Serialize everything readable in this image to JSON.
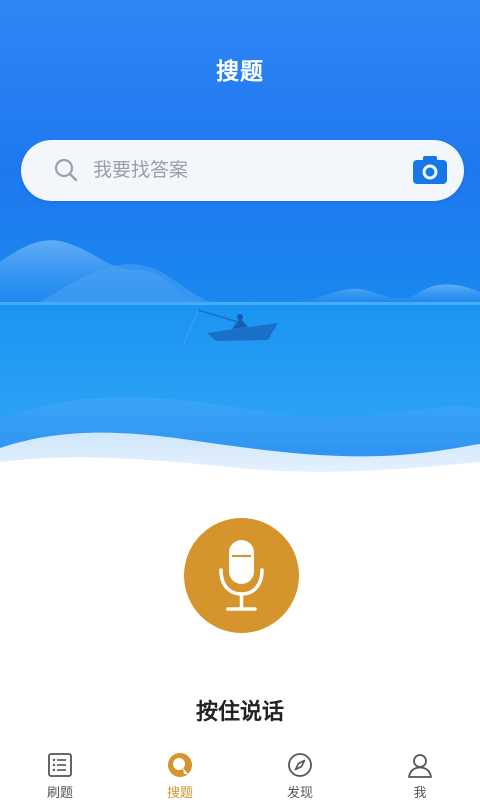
{
  "header": {
    "title": "搜题"
  },
  "search": {
    "placeholder": "我要找答案"
  },
  "icons": {
    "search": "search-icon",
    "camera": "camera-icon",
    "microphone": "microphone-icon",
    "tab_brush": "list-icon",
    "tab_search": "search-circle-icon",
    "tab_discover": "compass-icon",
    "tab_me": "person-icon"
  },
  "voice": {
    "label": "按住说话"
  },
  "tabs": [
    {
      "label": "刷题",
      "active": false
    },
    {
      "label": "搜题",
      "active": true
    },
    {
      "label": "发现",
      "active": false
    },
    {
      "label": "我",
      "active": false
    }
  ],
  "colors": {
    "primary_blue": "#1e78f0",
    "accent_gold": "#d6952c",
    "camera_blue": "#1677e6",
    "inactive_gray": "#555555"
  }
}
